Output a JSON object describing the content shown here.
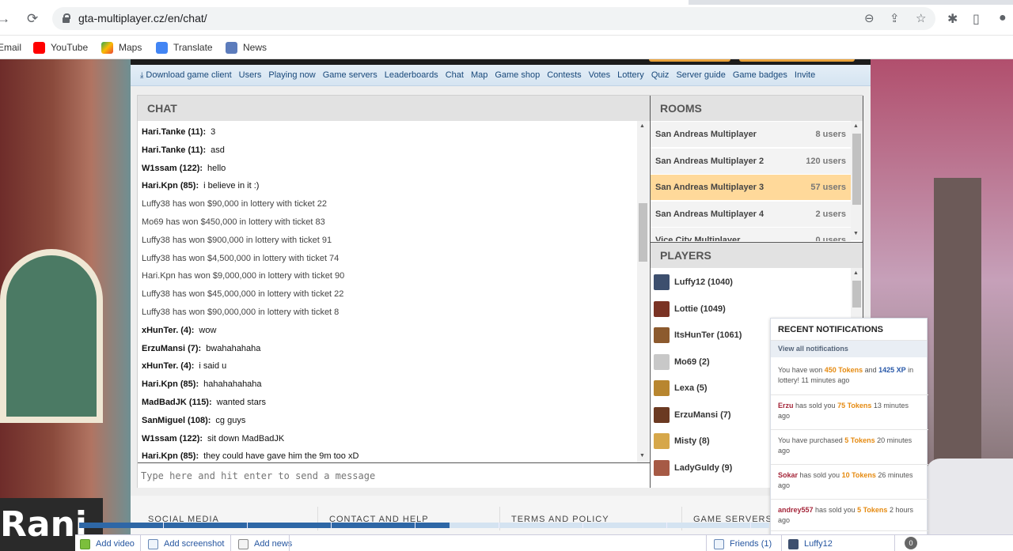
{
  "browser": {
    "url": "gta-multiplayer.cz/en/chat/",
    "bookmarks": [
      "Email",
      "YouTube",
      "Maps",
      "Translate",
      "News"
    ]
  },
  "nav": {
    "items": [
      "Download game client",
      "Users",
      "Playing now",
      "Game servers",
      "Leaderboards",
      "Chat",
      "Map",
      "Game shop",
      "Contests",
      "Votes",
      "Lottery",
      "Quiz",
      "Server guide",
      "Game badges",
      "Invite"
    ]
  },
  "chat": {
    "title": "CHAT",
    "input_placeholder": "Type here and hit enter to send a message",
    "messages": [
      {
        "user": "Hari.Tanke (11):",
        "text": "3"
      },
      {
        "user": "Hari.Tanke (11):",
        "text": "asd"
      },
      {
        "user": "W1ssam (122):",
        "text": "hello"
      },
      {
        "user": "Hari.Kpn (85):",
        "text": "i believe in it :)"
      },
      {
        "user": "",
        "text": "Luffy38 has won $90,000 in lottery with ticket 22"
      },
      {
        "user": "",
        "text": "Mo69 has won $450,000 in lottery with ticket 83"
      },
      {
        "user": "",
        "text": "Luffy38 has won $900,000 in lottery with ticket 91"
      },
      {
        "user": "",
        "text": "Luffy38 has won $4,500,000 in lottery with ticket 74"
      },
      {
        "user": "",
        "text": "Hari.Kpn has won $9,000,000 in lottery with ticket 90"
      },
      {
        "user": "",
        "text": "Luffy38 has won $45,000,000 in lottery with ticket 22"
      },
      {
        "user": "",
        "text": "Luffy38 has won $90,000,000 in lottery with ticket 8"
      },
      {
        "user": "xHunTer. (4):",
        "text": "wow"
      },
      {
        "user": "ErzuMansi (7):",
        "text": "bwahahahaha"
      },
      {
        "user": "xHunTer. (4):",
        "text": "i said u"
      },
      {
        "user": "Hari.Kpn (85):",
        "text": "hahahahahaha"
      },
      {
        "user": "MadBadJK (115):",
        "text": "wanted stars"
      },
      {
        "user": "SanMiguel (108):",
        "text": "cg guys"
      },
      {
        "user": "W1ssam (122):",
        "text": "sit down MadBadJK"
      },
      {
        "user": "Hari.Kpn (85):",
        "text": "they could have gave him the 9m too xD"
      }
    ]
  },
  "rooms": {
    "title": "ROOMS",
    "items": [
      {
        "name": "San Andreas Multiplayer",
        "users": "8 users",
        "active": false
      },
      {
        "name": "San Andreas Multiplayer 2",
        "users": "120 users",
        "active": false
      },
      {
        "name": "San Andreas Multiplayer 3",
        "users": "57 users",
        "active": true
      },
      {
        "name": "San Andreas Multiplayer 4",
        "users": "2 users",
        "active": false
      },
      {
        "name": "Vice City Multiplayer",
        "users": "0 users",
        "active": false
      }
    ]
  },
  "players": {
    "title": "PLAYERS",
    "items": [
      {
        "name": "Luffy12 (1040)",
        "color": "#3d4f6e"
      },
      {
        "name": "Lottie (1049)",
        "color": "#7a3324"
      },
      {
        "name": "ItsHunTer (1061)",
        "color": "#8c5a2e"
      },
      {
        "name": "Mo69 (2)",
        "color": "#c8c8c8"
      },
      {
        "name": "Lexa (5)",
        "color": "#b8862f"
      },
      {
        "name": "ErzuMansi (7)",
        "color": "#6b3a22"
      },
      {
        "name": "Misty (8)",
        "color": "#d6a74a"
      },
      {
        "name": "LadyGuldy (9)",
        "color": "#a65a45"
      }
    ]
  },
  "footer": {
    "headings": [
      "SOCIAL MEDIA",
      "CONTACT AND HELP",
      "TERMS AND POLICY",
      "GAME SERVERS"
    ]
  },
  "notifications": {
    "title": "RECENT NOTIFICATIONS",
    "view_all": "View all notifications",
    "items": [
      {
        "parts": [
          [
            "t",
            "You have won "
          ],
          [
            "tok",
            "450 Tokens"
          ],
          [
            "t",
            " and "
          ],
          [
            "xp",
            "1425 XP"
          ],
          [
            "t",
            " in lottery! 11 minutes ago"
          ]
        ]
      },
      {
        "parts": [
          [
            "usr",
            "Erzu"
          ],
          [
            "t",
            " has sold you "
          ],
          [
            "tok",
            "75 Tokens"
          ],
          [
            "t",
            " 13 minutes ago"
          ]
        ]
      },
      {
        "parts": [
          [
            "t",
            "You have purchased "
          ],
          [
            "tok",
            "5 Tokens"
          ],
          [
            "t",
            " 20 minutes ago"
          ]
        ]
      },
      {
        "parts": [
          [
            "usr",
            "Sokar"
          ],
          [
            "t",
            " has sold you "
          ],
          [
            "tok",
            "10 Tokens"
          ],
          [
            "t",
            " 26 minutes ago"
          ]
        ]
      },
      {
        "parts": [
          [
            "usr",
            "andrey557"
          ],
          [
            "t",
            " has sold you "
          ],
          [
            "tok",
            "5 Tokens"
          ],
          [
            "t",
            " 2 hours ago"
          ]
        ]
      }
    ]
  },
  "bottombar": {
    "add_video": "Add video",
    "add_screenshot": "Add screenshot",
    "add_news": "Add news",
    "friends": "Friends (1)",
    "user": "Luffy12",
    "settings_badge": "0"
  },
  "colors": {
    "nav_link": "#18487a",
    "active_room": "#ffd99a",
    "token": "#e58a10",
    "xp": "#2858a8"
  }
}
